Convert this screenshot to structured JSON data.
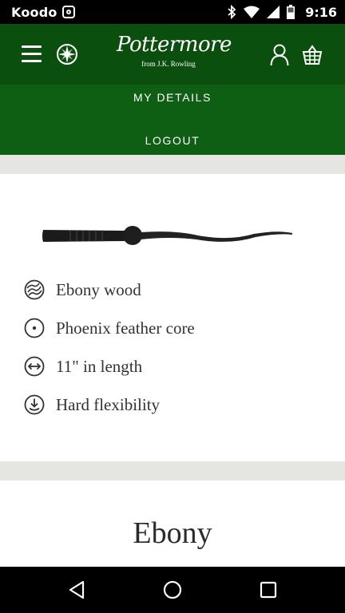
{
  "status_bar": {
    "carrier": "Koodo",
    "time": "9:16",
    "icons": [
      "instagram-icon",
      "bluetooth-icon",
      "wifi-icon",
      "signal-icon",
      "battery-icon"
    ]
  },
  "header": {
    "logo_word": "Pottermore",
    "logo_sub": "from J.K. Rowling",
    "icons": [
      "menu-icon",
      "compass-icon",
      "user-icon",
      "basket-icon"
    ],
    "colors": {
      "header_bg": "#0a4f0e",
      "menu_bg": "#0e5e14"
    }
  },
  "menu": {
    "my_details": "MY DETAILS",
    "logout": "LOGOUT"
  },
  "wand": {
    "attributes": [
      {
        "icon": "wood-grain-icon",
        "label": "Ebony wood"
      },
      {
        "icon": "core-icon",
        "label": "Phoenix feather core"
      },
      {
        "icon": "length-icon",
        "label": "11\" in length"
      },
      {
        "icon": "flexibility-icon",
        "label": "Hard flexibility"
      }
    ]
  },
  "section": {
    "title": "Ebony"
  },
  "nav": {
    "icons": [
      "back-icon",
      "home-icon",
      "recents-icon"
    ]
  }
}
